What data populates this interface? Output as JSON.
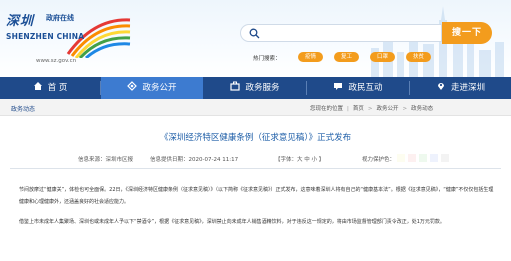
{
  "logo": {
    "name_cn": "深圳",
    "sub": "政府在线",
    "name_en": "SHENZHEN  CHINA",
    "url": "www.sz.gov.cn"
  },
  "search": {
    "placeholder": "",
    "button_label": "搜一下",
    "hot_label": "热门搜索：",
    "hot_words": [
      "疫情",
      "复工",
      "口罩",
      "扶贫"
    ]
  },
  "nav": {
    "items": [
      {
        "label": "首 页",
        "icon": "home-icon"
      },
      {
        "label": "政务公开",
        "icon": "gov-open-icon"
      },
      {
        "label": "政务服务",
        "icon": "service-icon"
      },
      {
        "label": "政民互动",
        "icon": "interaction-icon"
      },
      {
        "label": "走进深圳",
        "icon": "location-icon"
      }
    ],
    "active_index": 1
  },
  "breadcrumb": {
    "section": "政务动态",
    "prefix": "您现在的位置",
    "items": [
      "首页",
      "政务公开",
      "政务动态"
    ]
  },
  "article": {
    "title": "《深圳经济特区健康条例（征求意见稿）》正式发布",
    "source_label": "信息来源：深圳市区报",
    "date_label": "信息提供日期：2020-07-24 11:17",
    "font_label": "【字体：大 中 小 】",
    "theme_label": "视力保护色：",
    "paragraphs": [
      "节间放摩过“健康关”，体检也可全面保。22日，《深圳经济特区健康条例（征求意见稿）》（以下简称《征求意见稿》）正式发布，这意味着深圳人将有自己的“健康基本法”。根据《征求意见稿》，“健康”不仅仅包括生理健康和心理健康外，还涵盖良好的社会适应能力。",
      "借鉴上市未成年人集聚场、深圳也或未成年人予以下“禁酒令”，根据《征求意见稿》，深圳禁止向未成年人销售酒精饮料，对于违反这一规定的，将由市场监督管理部门责令改正，处1万元罚款。"
    ]
  },
  "colors": {
    "nav_bg": "#1f4a8a",
    "nav_active": "#3d7bd0",
    "accent": "#f39c1d",
    "title": "#1f5fa8",
    "swatches": [
      "#fdfdf0",
      "#fdf0f0",
      "#eef9ee",
      "#eef2fd",
      "#f3f3f3"
    ]
  }
}
